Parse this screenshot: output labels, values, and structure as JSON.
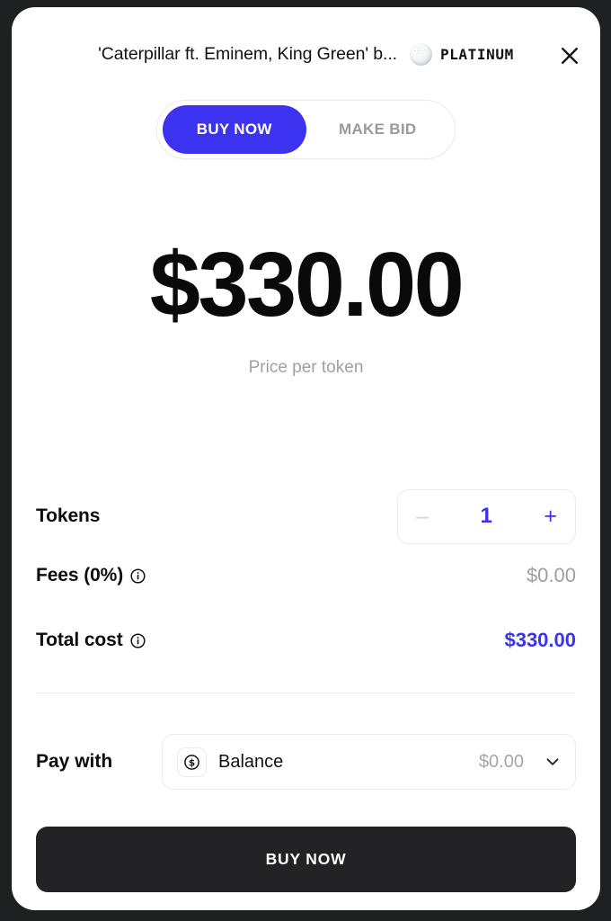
{
  "header": {
    "item_title": "'Caterpillar ft. Eminem, King Green' b...",
    "badge_label": "PLATINUM",
    "badge_icon": "platinum-sphere-icon",
    "close_icon": "close-icon"
  },
  "tabs": [
    {
      "label": "BUY NOW",
      "active": true
    },
    {
      "label": "MAKE BID",
      "active": false
    }
  ],
  "price": {
    "value": "$330.00",
    "caption": "Price per token"
  },
  "rows": {
    "tokens": {
      "label": "Tokens",
      "decrement": "–",
      "quantity": "1",
      "increment": "+"
    },
    "fees": {
      "label": "Fees (0%)",
      "info_icon": "info-icon",
      "value": "$0.00"
    },
    "total": {
      "label": "Total cost",
      "info_icon": "info-icon",
      "value": "$330.00"
    }
  },
  "pay_with": {
    "label": "Pay with",
    "method_icon": "dollar-coin-icon",
    "method_name": "Balance",
    "method_amount": "$0.00",
    "chevron_icon": "chevron-down-icon"
  },
  "cta": {
    "label": "BUY NOW"
  },
  "colors": {
    "accent": "#3b33f0",
    "cta_bg": "#232325",
    "muted_text": "#9e9ea2",
    "backdrop": "#1f2022"
  }
}
